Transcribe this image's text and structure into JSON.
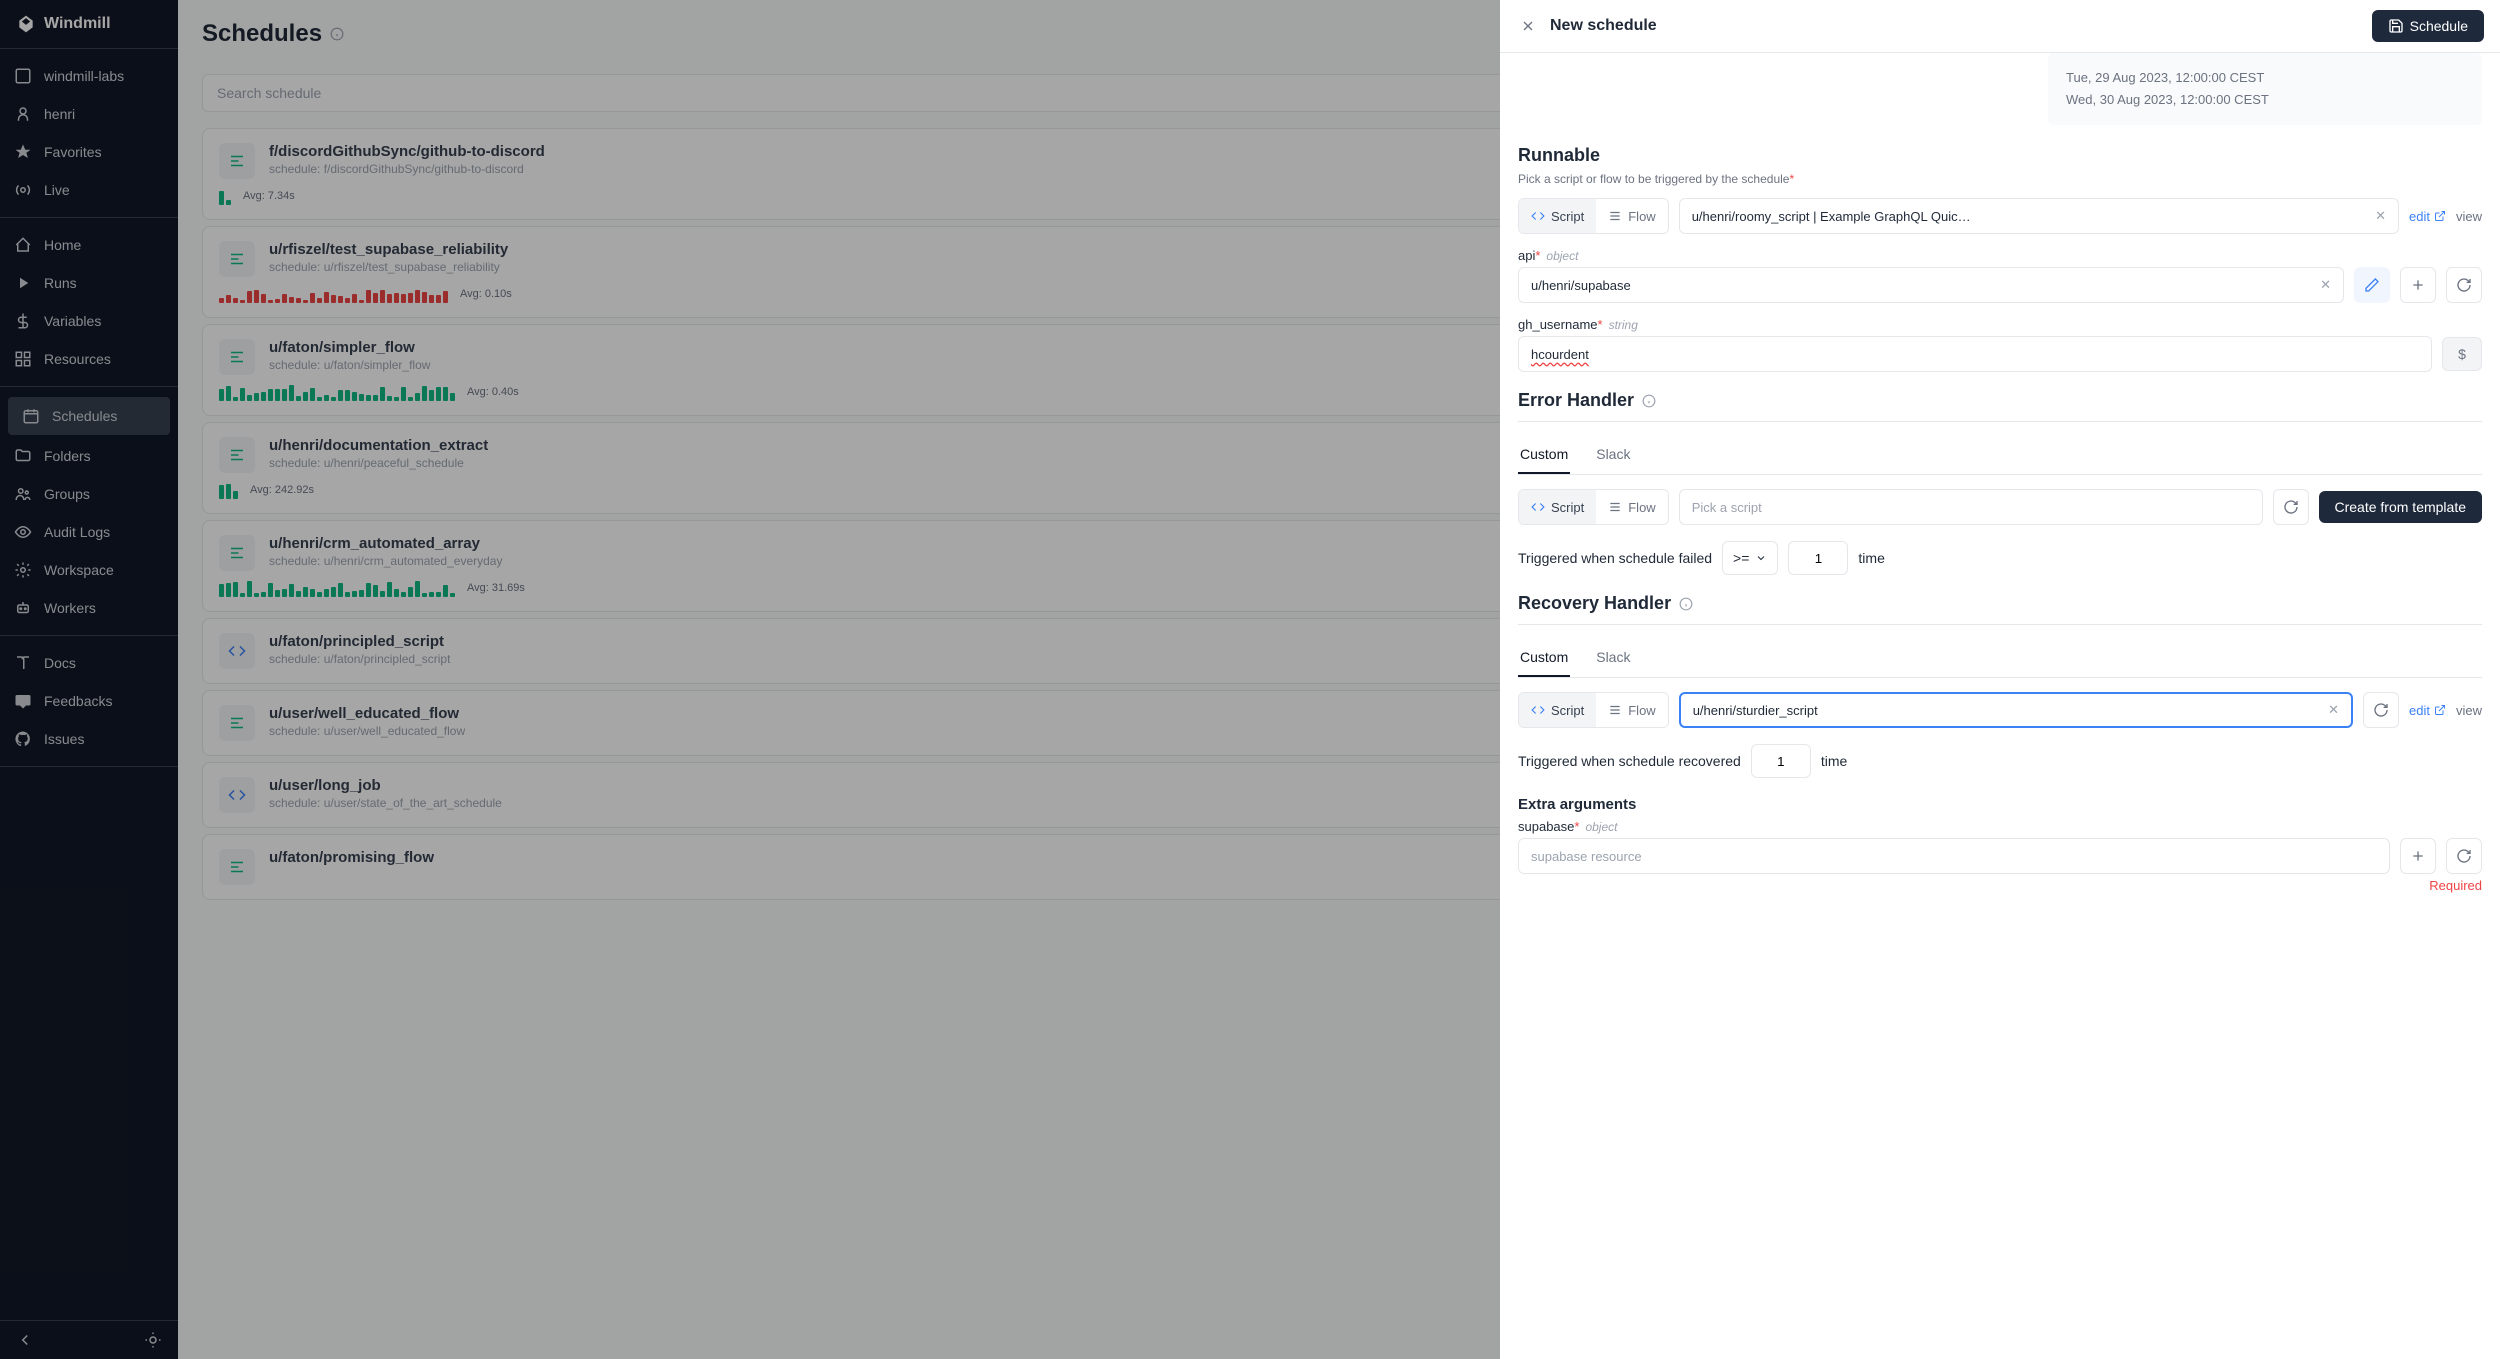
{
  "brand": "Windmill",
  "sidebar": {
    "workspace": "windmill-labs",
    "user": "henri",
    "items_top": [
      "Favorites",
      "Live"
    ],
    "items_main": [
      "Home",
      "Runs",
      "Variables",
      "Resources"
    ],
    "items_config": [
      "Schedules",
      "Folders",
      "Groups",
      "Audit Logs",
      "Workspace",
      "Workers"
    ],
    "items_help": [
      "Docs",
      "Feedbacks",
      "Issues"
    ]
  },
  "main": {
    "title": "Schedules",
    "search_placeholder": "Search schedule"
  },
  "schedules": [
    {
      "title": "f/discordGithubSync/github-to-discord",
      "sub": "schedule: f/discordGithubSync/github-to-discord",
      "avg": "Avg: 7.34s",
      "type": "flow",
      "bars_g": 2,
      "bars_r": 0
    },
    {
      "title": "u/rfiszel/test_supabase_reliability",
      "sub": "schedule: u/rfiszel/test_supabase_reliability",
      "avg": "Avg: 0.10s",
      "type": "flow",
      "bars_g": 0,
      "bars_r": 33
    },
    {
      "title": "u/faton/simpler_flow",
      "sub": "schedule: u/faton/simpler_flow",
      "avg": "Avg: 0.40s",
      "type": "flow",
      "bars_g": 34,
      "bars_r": 0
    },
    {
      "title": "u/henri/documentation_extract",
      "sub": "schedule: u/henri/peaceful_schedule",
      "avg": "Avg: 242.92s",
      "type": "flow",
      "bars_g": 3,
      "bars_r": 0
    },
    {
      "title": "u/henri/crm_automated_array",
      "sub": "schedule: u/henri/crm_automated_everyday",
      "avg": "Avg: 31.69s",
      "type": "flow",
      "bars_g": 34,
      "bars_r": 0
    },
    {
      "title": "u/faton/principled_script",
      "sub": "schedule: u/faton/principled_script",
      "avg": "",
      "type": "script",
      "bars_g": 0,
      "bars_r": 0
    },
    {
      "title": "u/user/well_educated_flow",
      "sub": "schedule: u/user/well_educated_flow",
      "avg": "",
      "type": "flow",
      "bars_g": 0,
      "bars_r": 0
    },
    {
      "title": "u/user/long_job",
      "sub": "schedule: u/user/state_of_the_art_schedule",
      "avg": "",
      "type": "script",
      "bars_g": 0,
      "bars_r": 0
    },
    {
      "title": "u/faton/promising_flow",
      "sub": "",
      "avg": "",
      "type": "flow",
      "bars_g": 0,
      "bars_r": 0
    }
  ],
  "panel": {
    "title": "New schedule",
    "schedule_btn": "Schedule",
    "preview": [
      "Tue, 29 Aug 2023, 12:00:00 CEST",
      "Wed, 30 Aug 2023, 12:00:00 CEST"
    ],
    "runnable": {
      "title": "Runnable",
      "subtitle": "Pick a script or flow to be triggered by the schedule",
      "toggle": {
        "script": "Script",
        "flow": "Flow"
      },
      "script_value": "u/henri/roomy_script | Example GraphQL Quic…",
      "edit": "edit",
      "view": "view"
    },
    "api": {
      "label": "api",
      "type": "object",
      "value": "u/henri/supabase"
    },
    "gh_username": {
      "label": "gh_username",
      "type": "string",
      "value": "hcourdent"
    },
    "error_handler": {
      "title": "Error Handler",
      "tabs": {
        "custom": "Custom",
        "slack": "Slack"
      },
      "script_placeholder": "Pick a script",
      "create_btn": "Create from template",
      "trigger_text": "Triggered when schedule failed",
      "comparator": ">=",
      "count": "1",
      "time_label": "time"
    },
    "recovery_handler": {
      "title": "Recovery Handler",
      "tabs": {
        "custom": "Custom",
        "slack": "Slack"
      },
      "script_value": "u/henri/sturdier_script",
      "edit": "edit",
      "view": "view",
      "trigger_text": "Triggered when schedule recovered",
      "count": "1",
      "time_label": "time"
    },
    "extra_args": {
      "title": "Extra arguments",
      "supabase": {
        "label": "supabase",
        "type": "object",
        "placeholder": "supabase resource",
        "required": "Required"
      }
    }
  }
}
